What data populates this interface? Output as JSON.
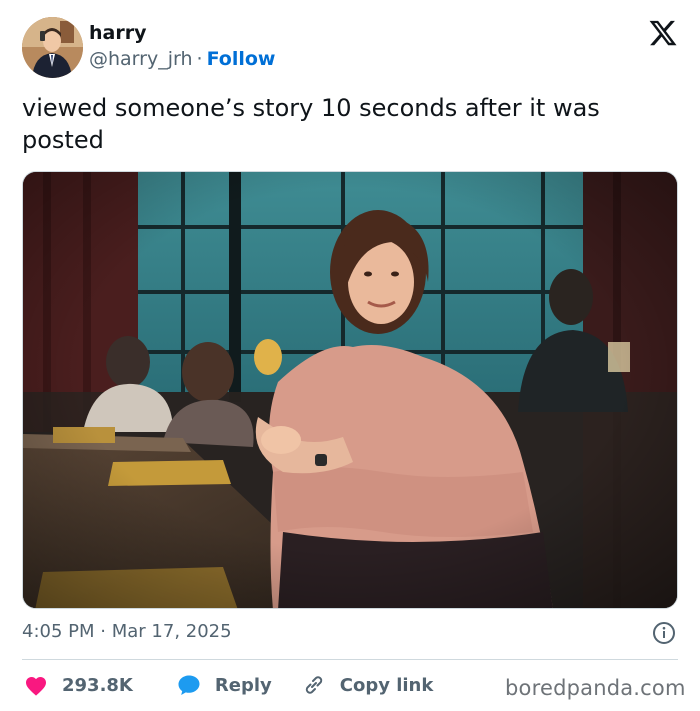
{
  "author": {
    "name": "harry",
    "handle": "@harry_jrh",
    "separator": "·",
    "follow_label": "Follow"
  },
  "tweet": {
    "text": "viewed someone’s story 10 seconds after it was posted"
  },
  "meta": {
    "time": "4:05 PM",
    "separator": "·",
    "date": "Mar 17, 2025"
  },
  "actions": {
    "likes": "293.8K",
    "reply_label": "Reply",
    "copy_label": "Copy link"
  },
  "watermark": "boredpanda.com",
  "icons": {
    "brand": "x-logo-icon",
    "info": "info-icon",
    "like": "heart-icon",
    "reply": "speech-bubble-icon",
    "copy": "link-icon"
  },
  "colors": {
    "link": "#006fd6",
    "heart": "#f91880",
    "reply": "#1d9bf0",
    "muted": "#536471",
    "text": "#0f1419"
  }
}
